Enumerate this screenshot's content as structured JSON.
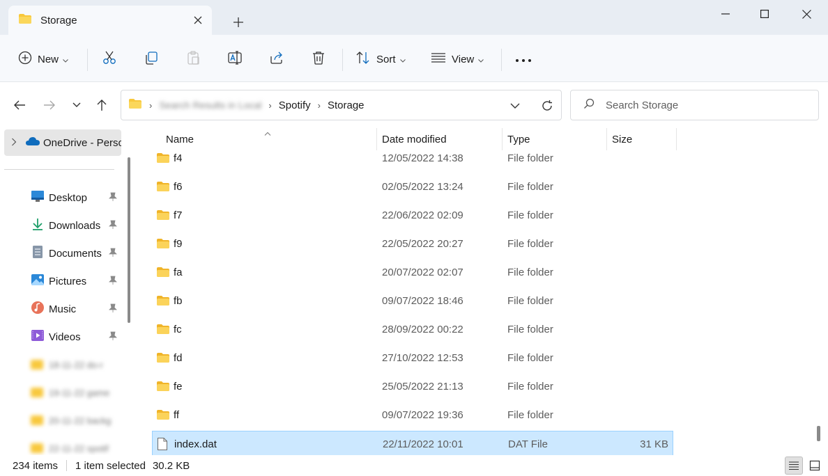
{
  "window": {
    "tab_title": "Storage",
    "controls": [
      "minimize",
      "maximize",
      "close"
    ]
  },
  "toolbar": {
    "new_label": "New",
    "sort_label": "Sort",
    "view_label": "View",
    "more_label": "..."
  },
  "address": {
    "hidden_crumb": "Search Results in Local",
    "crumbs": [
      "Spotify",
      "Storage"
    ],
    "search_placeholder": "Search Storage"
  },
  "sidebar": {
    "onedrive_label": "OneDrive - Perso",
    "items": [
      {
        "label": "Desktop",
        "icon": "desktop-icon"
      },
      {
        "label": "Downloads",
        "icon": "download-icon"
      },
      {
        "label": "Documents",
        "icon": "document-icon"
      },
      {
        "label": "Pictures",
        "icon": "picture-icon"
      },
      {
        "label": "Music",
        "icon": "music-icon"
      },
      {
        "label": "Videos",
        "icon": "video-icon"
      }
    ],
    "blurred_items": [
      "18-11-22 do-r",
      "19-11-22 game",
      "20-11-22 backg",
      "22-11-22 spotif"
    ]
  },
  "columns": {
    "name": "Name",
    "date": "Date modified",
    "type": "Type",
    "size": "Size"
  },
  "files": [
    {
      "name": "f4",
      "date": "12/05/2022 14:38",
      "type": "File folder",
      "size": "",
      "kind": "folder"
    },
    {
      "name": "f6",
      "date": "02/05/2022 13:24",
      "type": "File folder",
      "size": "",
      "kind": "folder"
    },
    {
      "name": "f7",
      "date": "22/06/2022 02:09",
      "type": "File folder",
      "size": "",
      "kind": "folder"
    },
    {
      "name": "f9",
      "date": "22/05/2022 20:27",
      "type": "File folder",
      "size": "",
      "kind": "folder"
    },
    {
      "name": "fa",
      "date": "20/07/2022 02:07",
      "type": "File folder",
      "size": "",
      "kind": "folder"
    },
    {
      "name": "fb",
      "date": "09/07/2022 18:46",
      "type": "File folder",
      "size": "",
      "kind": "folder"
    },
    {
      "name": "fc",
      "date": "28/09/2022 00:22",
      "type": "File folder",
      "size": "",
      "kind": "folder"
    },
    {
      "name": "fd",
      "date": "27/10/2022 12:53",
      "type": "File folder",
      "size": "",
      "kind": "folder"
    },
    {
      "name": "fe",
      "date": "25/05/2022 21:13",
      "type": "File folder",
      "size": "",
      "kind": "folder"
    },
    {
      "name": "ff",
      "date": "09/07/2022 19:36",
      "type": "File folder",
      "size": "",
      "kind": "folder"
    },
    {
      "name": "index.dat",
      "date": "22/11/2022 10:01",
      "type": "DAT File",
      "size": "31 KB",
      "kind": "file",
      "selected": true
    }
  ],
  "status": {
    "item_count": "234 items",
    "selection": "1 item selected",
    "selection_size": "30.2 KB"
  },
  "colors": {
    "selection_bg": "#cce8ff",
    "folder_yellow": "#f8c83c",
    "onedrive_blue": "#0f6cbd"
  }
}
